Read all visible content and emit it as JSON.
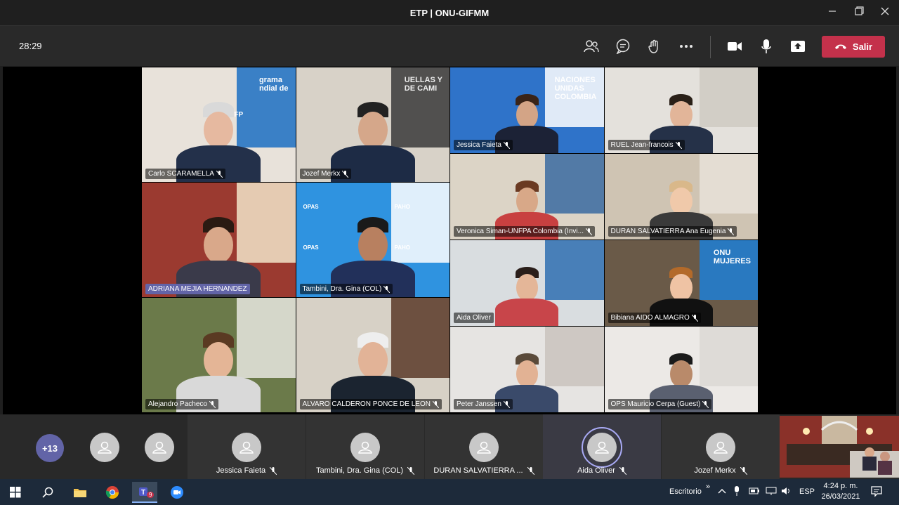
{
  "window": {
    "title": "ETP | ONU-GIFMM"
  },
  "toolbar": {
    "timer": "28:29",
    "leave_label": "Salir"
  },
  "tiles": [
    {
      "name": "Carlo SCARAMELLA",
      "watermark": "WFP",
      "wm_text": "grama\nndial de"
    },
    {
      "name": "Jozef Merkx",
      "wm_text": "UELLAS Y\nDE CAMI"
    },
    {
      "name": "Jessica Faieta",
      "wm_text": "NACIONES\nUNIDAS\nCOLOMBIA"
    },
    {
      "name": "RUEL Jean-francois"
    },
    {
      "name": "ADRIANA MEJIA HERNANDEZ"
    },
    {
      "name": "Tambini, Dra. Gina (COL)",
      "logo_a": "OPAS",
      "logo_b": "PAHO"
    },
    {
      "name": "Veronica Siman-UNFPA Colombia (Invi..."
    },
    {
      "name": "DURAN SALVATIERRA Ana Eugenia"
    },
    {
      "name": "Alejandro Pacheco"
    },
    {
      "name": "ALVARO CALDERON PONCE DE LEON"
    },
    {
      "name": "Aida Oliver"
    },
    {
      "name": "Bibiana AIDO ALMAGRO",
      "wm_text": "ONU\nMUJERES"
    },
    {
      "name": "Peter Janssen"
    },
    {
      "name": "OPS Mauricio Cerpa (Guest)"
    }
  ],
  "strip": {
    "overflow_count": "+13",
    "participants": [
      {
        "name": "Jessica Faieta"
      },
      {
        "name": "Tambini, Dra. Gina (COL)"
      },
      {
        "name": "DURAN SALVATIERRA ..."
      },
      {
        "name": "Aida Oliver"
      },
      {
        "name": "Jozef Merkx"
      }
    ]
  },
  "taskbar": {
    "teams_badge": "9",
    "toolbar_label": "Escritorio",
    "lang": "ESP",
    "time": "4:24 p. m.",
    "date": "26/03/2021"
  },
  "colors": {
    "accent": "#6264a7",
    "leave": "#c4314b"
  }
}
